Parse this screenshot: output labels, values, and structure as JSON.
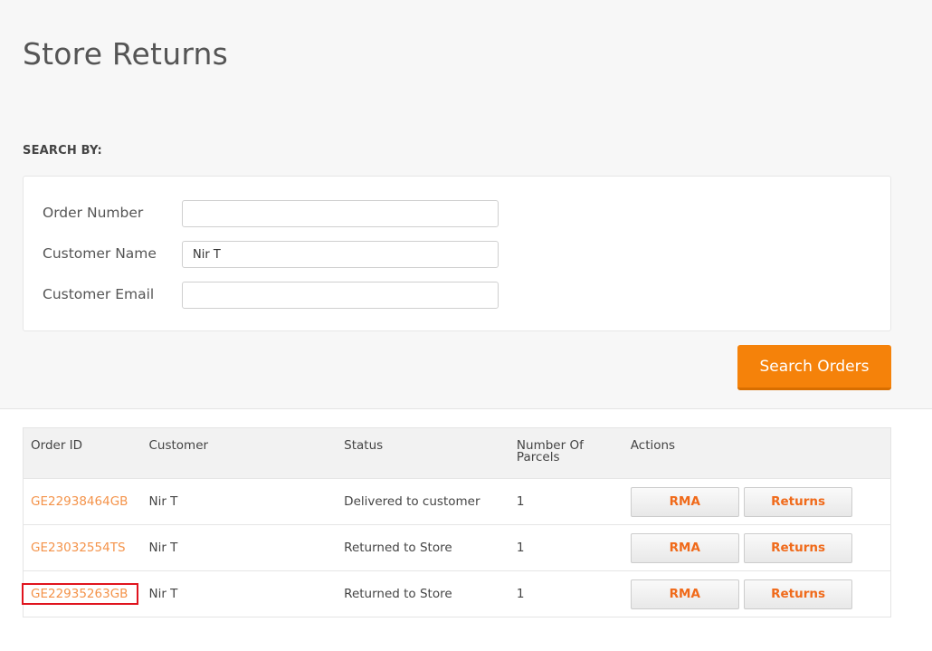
{
  "page": {
    "title": "Store Returns"
  },
  "search": {
    "heading": "SEARCH BY:",
    "fields": [
      {
        "label": "Order Number",
        "value": "",
        "placeholder": ""
      },
      {
        "label": "Customer Name",
        "value": "Nir T",
        "placeholder": ""
      },
      {
        "label": "Customer Email",
        "value": "",
        "placeholder": ""
      }
    ],
    "button_label": "Search Orders"
  },
  "table": {
    "headers": {
      "order_id": "Order ID",
      "customer": "Customer",
      "status": "Status",
      "parcels_line1": "Number Of",
      "parcels_line2": "Parcels",
      "actions": "Actions"
    },
    "rows": [
      {
        "order_id": "GE22938464GB",
        "customer": "Nir T",
        "status": "Delivered to customer",
        "parcels": "1",
        "rma_label": "RMA",
        "returns_label": "Returns"
      },
      {
        "order_id": "GE23032554TS",
        "customer": "Nir T",
        "status": "Returned to Store",
        "parcels": "1",
        "rma_label": "RMA",
        "returns_label": "Returns"
      },
      {
        "order_id": "GE22935263GB",
        "customer": "Nir T",
        "status": "Returned to Store",
        "parcels": "1",
        "rma_label": "RMA",
        "returns_label": "Returns"
      }
    ]
  },
  "colors": {
    "accent": "#f5820a",
    "link": "#f4934a",
    "action_text": "#f06a1a",
    "highlight": "#e0141e"
  }
}
